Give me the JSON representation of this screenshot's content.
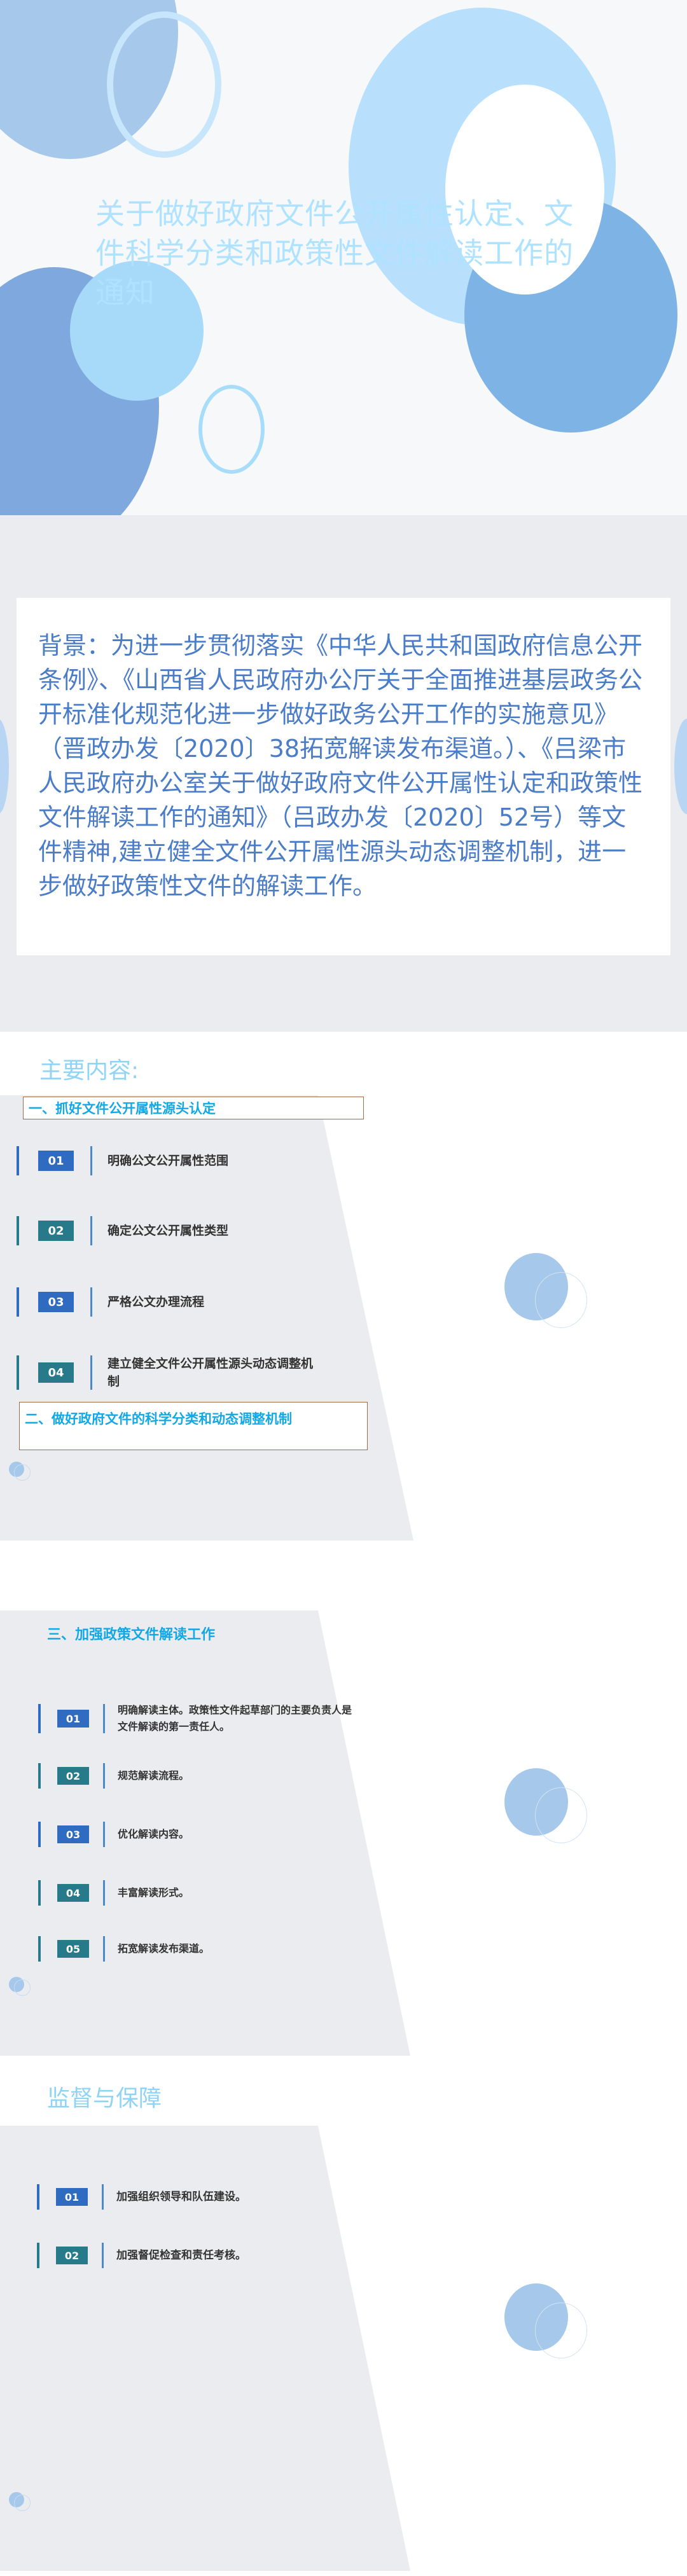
{
  "slide1": {
    "title": "关于做好政府文件公开属性认定、文件科学分类和政策性文件解读工作的通知"
  },
  "slide2": {
    "background_text": "背景：为进一步贯彻落实《中华人民共和国政府信息公开条例》、《山西省人民政府办公厅关于全面推进基层政务公开标准化规范化进一步做好政务公开工作的实施意见》（晋政办发〔2020〕38拓宽解读发布渠道。）、《吕梁市人民政府办公室关于做好政府文件公开属性认定和政策性文件解读工作的通知》（吕政办发〔2020〕52号）等文件精神,建立健全文件公开属性源头动态调整机制，进一步做好政策性文件的解读工作。"
  },
  "slide3": {
    "section_title": "主要内容:",
    "heading1": "一、抓好文件公开属性源头认定",
    "items": [
      {
        "num": "01",
        "label": "明确公文公开属性范围"
      },
      {
        "num": "02",
        "label": "确定公文公开属性类型"
      },
      {
        "num": "03",
        "label": "严格公文办理流程"
      },
      {
        "num": "04",
        "label": "建立健全文件公开属性源头动态调整机制"
      }
    ],
    "heading2": "二、做好政府文件的科学分类和动态调整机制"
  },
  "slide4": {
    "heading": "三、加强政策文件解读工作",
    "items": [
      {
        "num": "01",
        "label": "明确解读主体。政策性文件起草部门的主要负责人是文件解读的第一责任人。"
      },
      {
        "num": "02",
        "label": "规范解读流程。"
      },
      {
        "num": "03",
        "label": "优化解读内容。"
      },
      {
        "num": "04",
        "label": "丰富解读形式。"
      },
      {
        "num": "05",
        "label": "拓宽解读发布渠道。"
      }
    ]
  },
  "slide5": {
    "section_title": "监督与保障",
    "items": [
      {
        "num": "01",
        "label": "加强组织领导和队伍建设。"
      },
      {
        "num": "02",
        "label": "加强督促检查和责任考核。"
      }
    ]
  },
  "colors": {
    "num_blue": "#2f6cc1",
    "num_teal": "#277a8a",
    "title_light_blue": "#aee2ff",
    "heading_cyan": "#12a8e6",
    "body_blue": "#4a7cc7"
  }
}
